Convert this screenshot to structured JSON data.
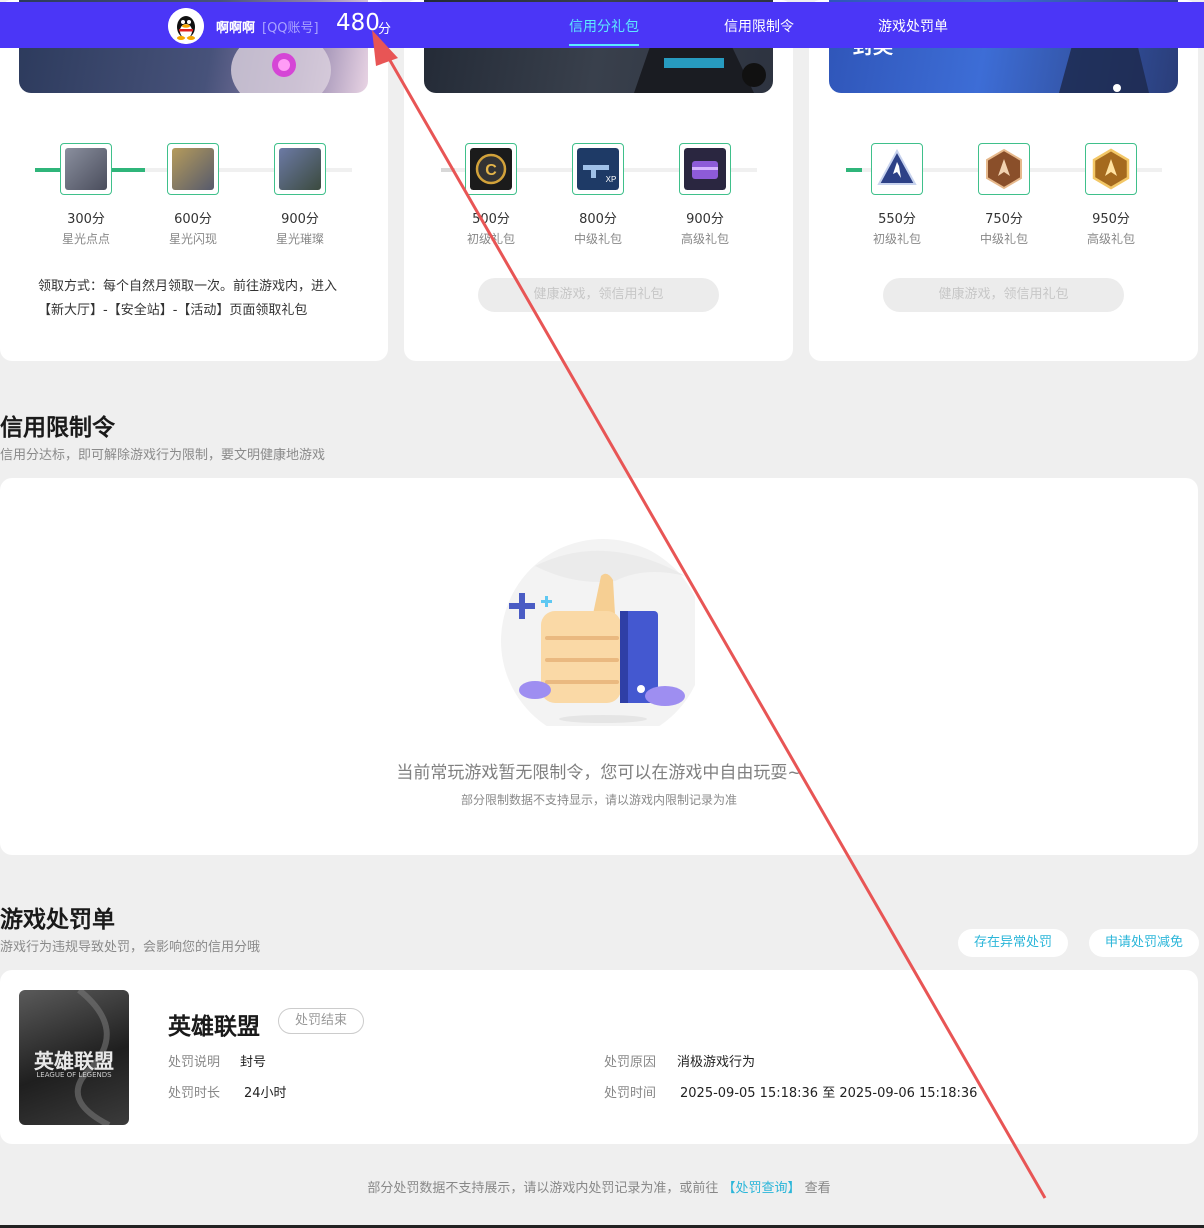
{
  "nav": {
    "username": "啊啊啊",
    "account_type": "[QQ账号]",
    "score": "480",
    "score_unit": "分",
    "tabs": [
      {
        "label": "信用分礼包",
        "active": true
      },
      {
        "label": "信用限制令",
        "active": false
      },
      {
        "label": "游戏处罚单",
        "active": false
      }
    ],
    "accent_color": "#4b36f7",
    "active_tab_color": "#5de9ff"
  },
  "gift_cards": [
    {
      "rewards": [
        {
          "points": "300分",
          "name": "星光点点"
        },
        {
          "points": "600分",
          "name": "星光闪现"
        },
        {
          "points": "900分",
          "name": "星光璀璨"
        }
      ],
      "note": "领取方式：每个自然月领取一次。前往游戏内，进入【新大厅】-【安全站】-【活动】页面领取礼包"
    },
    {
      "rewards": [
        {
          "points": "500分",
          "name": "初级礼包"
        },
        {
          "points": "800分",
          "name": "中级礼包"
        },
        {
          "points": "900分",
          "name": "高级礼包"
        }
      ],
      "button": "健康游戏，领信用礼包"
    },
    {
      "banner_text": "封奖",
      "rewards": [
        {
          "points": "550分",
          "name": "初级礼包"
        },
        {
          "points": "750分",
          "name": "中级礼包"
        },
        {
          "points": "950分",
          "name": "高级礼包"
        }
      ],
      "button": "健康游戏，领信用礼包"
    }
  ],
  "restriction": {
    "title": "信用限制令",
    "subtitle": "信用分达标，即可解除游戏行为限制，要文明健康地游戏",
    "empty_main": "当前常玩游戏暂无限制令，您可以在游戏中自由玩耍~",
    "empty_sub": "部分限制数据不支持显示，请以游戏内限制记录为准"
  },
  "penalty": {
    "title": "游戏处罚单",
    "subtitle": "游戏行为违规导致处罚，会影响您的信用分哦",
    "pill_abnormal": "存在异常处罚",
    "pill_reduce": "申请处罚减免",
    "record": {
      "game_logo_cn": "英雄联盟",
      "game_logo_en": "LEAGUE OF LEGENDS",
      "game": "英雄联盟",
      "status": "处罚结束",
      "desc_label": "处罚说明",
      "desc": "封号",
      "reason_label": "处罚原因",
      "reason": "消极游戏行为",
      "duration_label": "处罚时长",
      "duration": "24小时",
      "time_label": "处罚时间",
      "time": "2025-09-05 15:18:36 至 2025-09-06 15:18:36"
    }
  },
  "footer": {
    "text_before": "部分处罚数据不支持展示，请以游戏内处罚记录为准，或前往",
    "link": "【处罚查询】",
    "text_after": "查看"
  }
}
